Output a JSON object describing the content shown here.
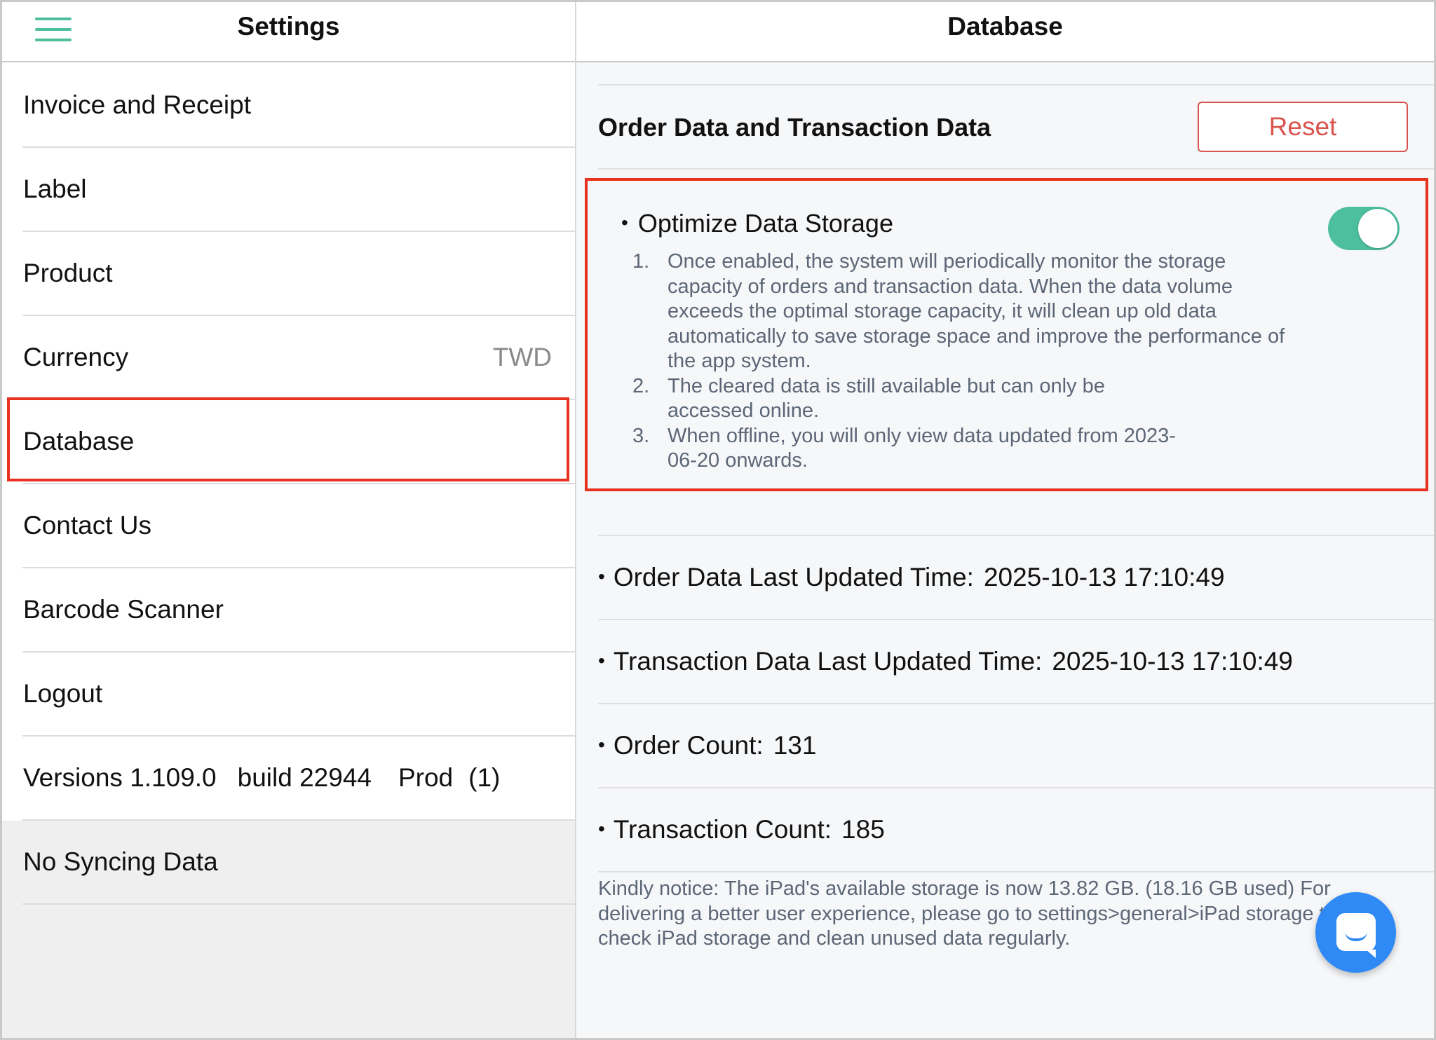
{
  "left": {
    "title": "Settings",
    "menu": [
      {
        "label": "Invoice and Receipt"
      },
      {
        "label": "Label"
      },
      {
        "label": "Product"
      },
      {
        "label": "Currency",
        "value": "TWD"
      },
      {
        "label": "Database"
      },
      {
        "label": "Contact Us"
      },
      {
        "label": "Barcode Scanner"
      },
      {
        "label": "Logout"
      }
    ],
    "version": {
      "version": "Versions 1.109.0",
      "build": "build 22944",
      "env": "Prod",
      "count": "(1)"
    },
    "sync_status": "No Syncing Data"
  },
  "right": {
    "title": "Database",
    "section_title": "Order Data and Transaction Data",
    "reset_label": "Reset",
    "optimize": {
      "bullet": "•",
      "title": "Optimize Data Storage",
      "enabled": true,
      "items": [
        {
          "num": "1.",
          "text": "Once enabled, the system will periodically monitor the storage capacity of orders and transaction data. When the data volume exceeds the optimal storage capacity, it will clean up old data automatically to save storage space and improve the performance of the app system."
        },
        {
          "num": "2.",
          "text": "The cleared data is still available but can only be accessed online."
        },
        {
          "num": "3.",
          "text": "When offline, you will only view data updated from 2023-06-20 onwards."
        }
      ]
    },
    "stats": [
      {
        "label": "Order Data Last Updated Time:",
        "value": "2025-10-13 17:10:49"
      },
      {
        "label": "Transaction Data Last Updated Time:",
        "value": "2025-10-13 17:10:49"
      },
      {
        "label": "Order Count:",
        "value": "131"
      },
      {
        "label": "Transaction Count:",
        "value": "185"
      }
    ],
    "notice": "Kindly notice: The iPad's available storage is now 13.82 GB. (18.16 GB used) For delivering a better user experience, please go to settings>general>iPad storage to check iPad storage and clean unused data regularly."
  },
  "colors": {
    "accent": "#4dbf9f",
    "danger": "#d9534f",
    "highlight": "#e8321f",
    "chat": "#2f8af5"
  },
  "icons": {
    "menu": "hamburger-icon",
    "chat": "chat-bubble-icon"
  }
}
